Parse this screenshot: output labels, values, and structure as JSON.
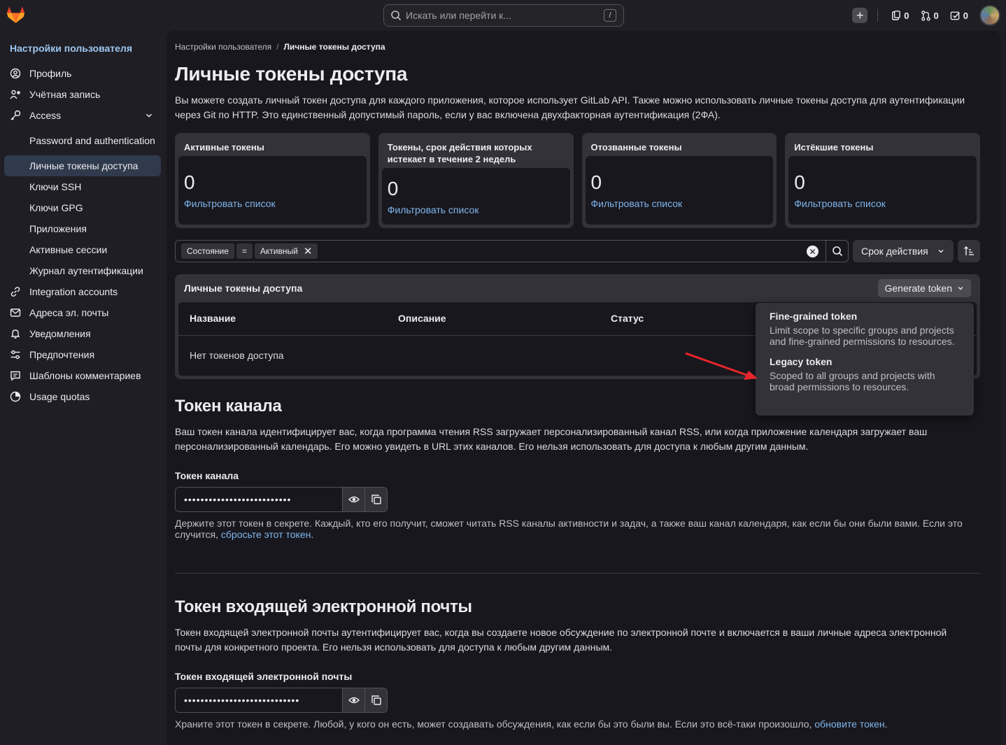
{
  "topbar": {
    "search_placeholder": "Искать или перейти к...",
    "search_shortcut": "/",
    "counters": [
      {
        "icon": "issues-icon",
        "count": "0"
      },
      {
        "icon": "merge-request-icon",
        "count": "0"
      },
      {
        "icon": "todo-icon",
        "count": "0"
      }
    ]
  },
  "sidebar": {
    "title": "Настройки пользователя",
    "items": [
      {
        "label": "Профиль",
        "icon": "profile-icon"
      },
      {
        "label": "Учётная запись",
        "icon": "account-icon"
      },
      {
        "label": "Access",
        "icon": "key-icon"
      },
      {
        "label": "Password and authentication"
      },
      {
        "label": "Личные токены доступа"
      },
      {
        "label": "Ключи SSH"
      },
      {
        "label": "Ключи GPG"
      },
      {
        "label": "Приложения"
      },
      {
        "label": "Активные сессии"
      },
      {
        "label": "Журнал аутентификации"
      },
      {
        "label": "Integration accounts",
        "icon": "link-icon"
      },
      {
        "label": "Адреса эл. почты",
        "icon": "mail-icon"
      },
      {
        "label": "Уведомления",
        "icon": "bell-icon"
      },
      {
        "label": "Предпочтения",
        "icon": "preferences-icon"
      },
      {
        "label": "Шаблоны комментариев",
        "icon": "comment-icon"
      },
      {
        "label": "Usage quotas",
        "icon": "quota-icon"
      }
    ]
  },
  "breadcrumb": {
    "parent": "Настройки пользователя",
    "separator": "/",
    "current": "Личные токены доступа"
  },
  "page": {
    "title": "Личные токены доступа",
    "lead": "Вы можете создать личный токен доступа для каждого приложения, которое использует GitLab API. Также можно использовать личные токены доступа для аутентификации через Git по HTTP. Это единственный допустимый пароль, если у вас включена двухфакторная аутентификация (2ФА)."
  },
  "cards": [
    {
      "title": "Активные токены",
      "count": "0",
      "link": "Фильтровать список"
    },
    {
      "title": "Токены, срок действия которых истекает в течение 2 недель",
      "count": "0",
      "link": "Фильтровать список"
    },
    {
      "title": "Отозванные токены",
      "count": "0",
      "link": "Фильтровать список"
    },
    {
      "title": "Истёкшие токены",
      "count": "0",
      "link": "Фильтровать список"
    }
  ],
  "filter": {
    "token_field": "Состояние",
    "token_op": "=",
    "token_value": "Активный",
    "sort_label": "Срок действия"
  },
  "tokens_table": {
    "title": "Личные токены доступа",
    "generate_label": "Generate token",
    "columns": [
      "Название",
      "Описание",
      "Статус"
    ],
    "empty": "Нет токенов доступа"
  },
  "generate_menu": [
    {
      "title": "Fine-grained token",
      "desc": "Limit scope to specific groups and projects and fine-grained permissions to resources."
    },
    {
      "title": "Legacy token",
      "desc": "Scoped to all groups and projects with broad permissions to resources."
    }
  ],
  "feed": {
    "title": "Токен канала",
    "desc": "Ваш токен канала идентифицирует вас, когда программа чтения RSS загружает персонализированный канал RSS, или когда приложение календаря загружает ваш персонализированный календарь. Его можно увидеть в URL этих каналов. Его нельзя использовать для доступа к любым другим данным.",
    "field_label": "Токен канала",
    "masked": "••••••••••••••••••••••••••",
    "help_prefix": "Держите этот токен в секрете. Каждый, кто его получит, сможет читать RSS каналы активности и задач, а также ваш канал календаря, как если бы они были вами. Если это случится, ",
    "help_link": "сбросьте этот токен",
    "help_suffix": "."
  },
  "incoming": {
    "title": "Токен входящей электронной почты",
    "desc": "Токен входящей электронной почты аутентифицирует вас, когда вы создаете новое обсуждение по электронной почте и включается в ваши личные адреса электронной почты для конкретного проекта. Его нельзя использовать для доступа к любым другим данным.",
    "field_label": "Токен входящей электронной почты",
    "masked": "••••••••••••••••••••••••••••",
    "help_prefix": "Храните этот токен в секрете. Любой, у кого он есть, может создавать обсуждения, как если бы это были вы. Если это всё-таки произошло, ",
    "help_link": "обновите токен",
    "help_suffix": "."
  },
  "colors": {
    "accent_link": "#7fb6ed",
    "annotation_arrow": "#e8262b"
  }
}
